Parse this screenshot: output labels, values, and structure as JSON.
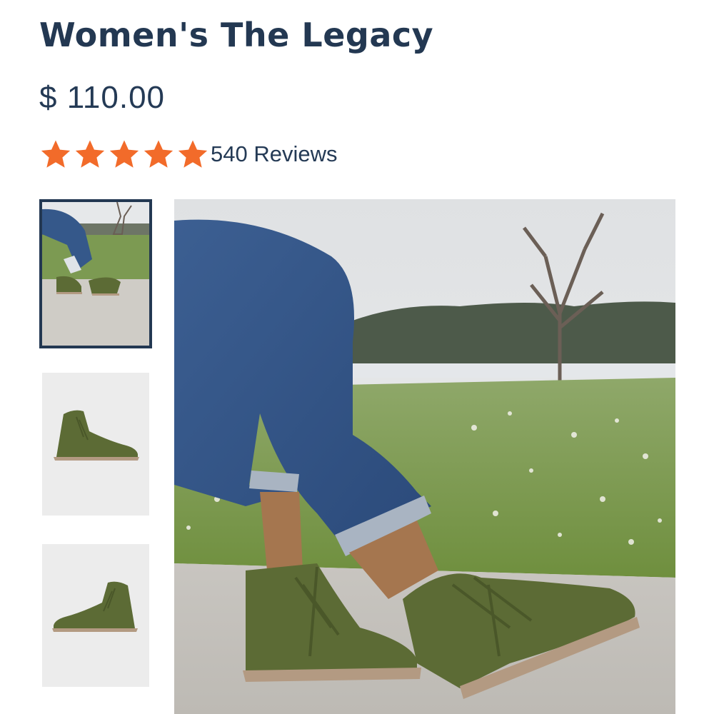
{
  "product": {
    "title": "Women's The Legacy",
    "price": "$ 110.00",
    "rating": {
      "stars": 5,
      "max": 5,
      "reviews_label": "540 Reviews",
      "star_color": "#f26b2a"
    }
  },
  "gallery": {
    "selected_index": 0,
    "thumbnails": [
      {
        "icon": "lifestyle-photo"
      },
      {
        "icon": "shoe-side-photo"
      },
      {
        "icon": "shoe-side-photo-right"
      }
    ],
    "main_image": {
      "icon": "lifestyle-photo"
    }
  },
  "colors": {
    "heading": "#233852",
    "shoe": "#5c6b35",
    "sole": "#b39a82",
    "active_border": "#233852"
  }
}
